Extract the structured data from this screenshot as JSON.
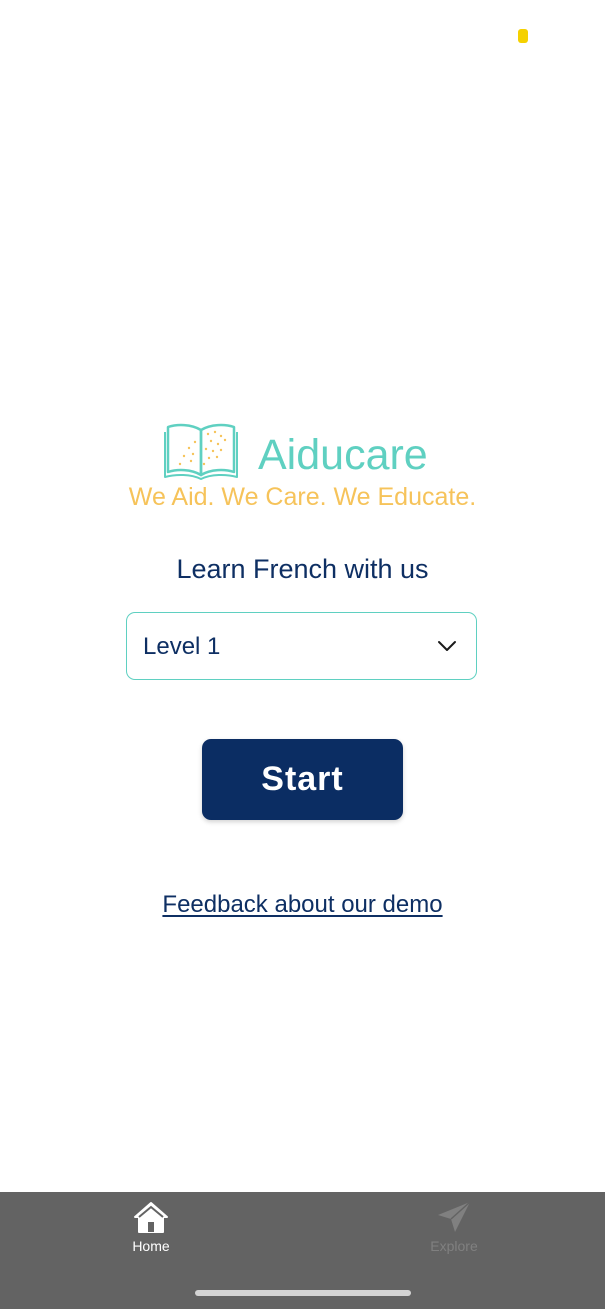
{
  "brand": {
    "name": "Aiducare",
    "tagline": "We Aid. We Care. We Educate.",
    "colors": {
      "teal": "#5fd0c1",
      "gold": "#f6c35a",
      "navy": "#0b2d63"
    }
  },
  "main": {
    "headline": "Learn French with us",
    "level_select": {
      "value": "Level 1",
      "icon": "chevron-down-icon"
    },
    "start_button": "Start",
    "feedback_link": "Feedback about our demo"
  },
  "tab_bar": {
    "tabs": [
      {
        "label": "Home",
        "icon": "home-icon",
        "active": true
      },
      {
        "label": "Explore",
        "icon": "send-icon",
        "active": false
      }
    ]
  }
}
